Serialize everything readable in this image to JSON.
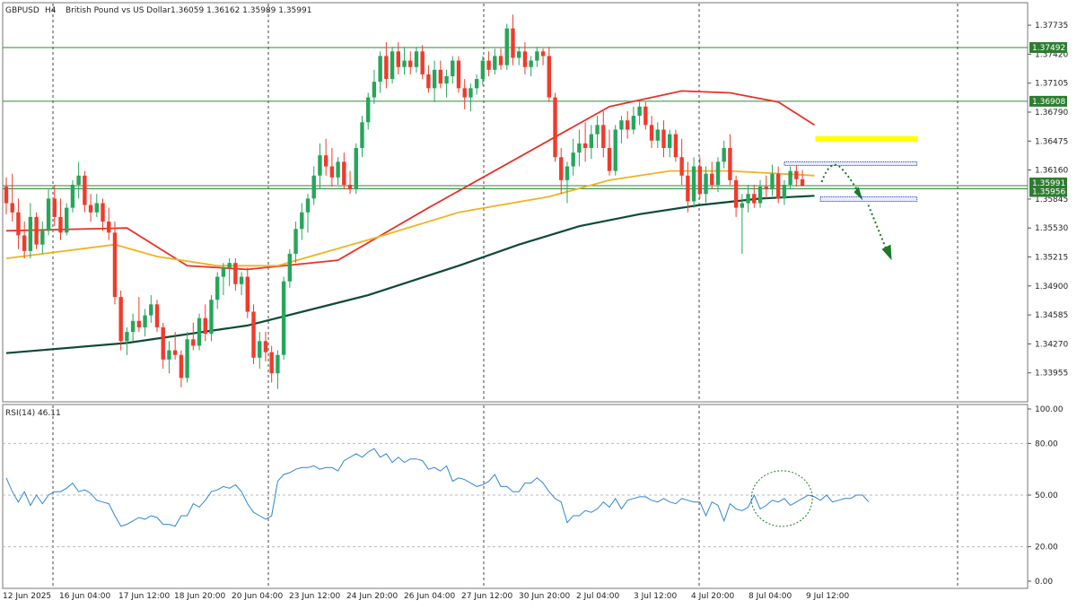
{
  "colors": {
    "bull": "#26a65b",
    "bear": "#ef3b2c",
    "ma_fast": "#e8322a",
    "ma_mid": "#f0b323",
    "ma_slow": "#0f4a33",
    "rsi": "#2f86d6",
    "level_line": "#2e8b3c",
    "resistance_zone": "#ffff00",
    "box_border": "#1f2fbf",
    "arrow": "#1a7a2a",
    "label_bg": "#2e7d32"
  },
  "header": {
    "symbol": "GBPUSD",
    "timeframe": "H4",
    "description": "British Pound vs US Dollar",
    "ohlc": "1.36059 1.36162 1.35989 1.35991"
  },
  "chart_data": [
    {
      "type": "candlestick",
      "y_ticks": [
        "1.37735",
        "1.37420",
        "1.37105",
        "1.36790",
        "1.36475",
        "1.36160",
        "1.35845",
        "1.35530",
        "1.35215",
        "1.34900",
        "1.34585",
        "1.34270",
        "1.33955"
      ],
      "ylim": [
        1.3365,
        1.3797
      ],
      "x_tick_labels": [
        "12 Jun 2025",
        "16 Jun 04:00",
        "17 Jun 12:00",
        "18 Jun 20:00",
        "20 Jun 04:00",
        "23 Jun 12:00",
        "24 Jun 20:00",
        "26 Jun 04:00",
        "27 Jun 12:00",
        "30 Jun 20:00",
        "2 Jul 04:00",
        "3 Jul 12:00",
        "4 Jul 20:00",
        "8 Jul 04:00",
        "9 Jul 12:00"
      ],
      "ohlc": [
        [
          1.3598,
          1.3608,
          1.3568,
          1.358
        ],
        [
          1.358,
          1.3612,
          1.356,
          1.357
        ],
        [
          1.357,
          1.3585,
          1.353,
          1.3545
        ],
        [
          1.3545,
          1.356,
          1.352,
          1.3528
        ],
        [
          1.3528,
          1.358,
          1.352,
          1.3565
        ],
        [
          1.3565,
          1.357,
          1.353,
          1.3535
        ],
        [
          1.3535,
          1.356,
          1.3525,
          1.355
        ],
        [
          1.355,
          1.3595,
          1.3545,
          1.3585
        ],
        [
          1.3585,
          1.36,
          1.3555,
          1.3565
        ],
        [
          1.3565,
          1.3585,
          1.354,
          1.3548
        ],
        [
          1.3548,
          1.358,
          1.3545,
          1.3575
        ],
        [
          1.3575,
          1.3605,
          1.357,
          1.36
        ],
        [
          1.36,
          1.3625,
          1.3585,
          1.361
        ],
        [
          1.361,
          1.3615,
          1.357,
          1.3578
        ],
        [
          1.3578,
          1.359,
          1.356,
          1.357
        ],
        [
          1.357,
          1.359,
          1.3565,
          1.358
        ],
        [
          1.358,
          1.3585,
          1.355,
          1.356
        ],
        [
          1.356,
          1.3575,
          1.354,
          1.3548
        ],
        [
          1.3548,
          1.356,
          1.347,
          1.3478
        ],
        [
          1.3478,
          1.3485,
          1.342,
          1.343
        ],
        [
          1.343,
          1.3445,
          1.3415,
          1.344
        ],
        [
          1.344,
          1.346,
          1.343,
          1.3452
        ],
        [
          1.3452,
          1.3478,
          1.344,
          1.3445
        ],
        [
          1.3445,
          1.3465,
          1.3435,
          1.3458
        ],
        [
          1.3458,
          1.348,
          1.345,
          1.347
        ],
        [
          1.347,
          1.3475,
          1.344,
          1.3445
        ],
        [
          1.3445,
          1.345,
          1.34,
          1.341
        ],
        [
          1.341,
          1.343,
          1.3395,
          1.342
        ],
        [
          1.342,
          1.344,
          1.341,
          1.3415
        ],
        [
          1.3415,
          1.342,
          1.338,
          1.339
        ],
        [
          1.339,
          1.344,
          1.3385,
          1.3432
        ],
        [
          1.3432,
          1.345,
          1.342,
          1.3425
        ],
        [
          1.3425,
          1.346,
          1.342,
          1.3455
        ],
        [
          1.3455,
          1.347,
          1.343,
          1.3438
        ],
        [
          1.3438,
          1.348,
          1.343,
          1.3475
        ],
        [
          1.3475,
          1.3505,
          1.3465,
          1.35
        ],
        [
          1.35,
          1.3515,
          1.348,
          1.351
        ],
        [
          1.351,
          1.352,
          1.349,
          1.3515
        ],
        [
          1.3515,
          1.352,
          1.3485,
          1.3492
        ],
        [
          1.3492,
          1.3505,
          1.348,
          1.35
        ],
        [
          1.35,
          1.351,
          1.3455,
          1.3462
        ],
        [
          1.3462,
          1.347,
          1.3405,
          1.3412
        ],
        [
          1.3412,
          1.344,
          1.34,
          1.343
        ],
        [
          1.343,
          1.344,
          1.3408,
          1.3418
        ],
        [
          1.3418,
          1.3425,
          1.3385,
          1.3395
        ],
        [
          1.3395,
          1.342,
          1.3378,
          1.3415
        ],
        [
          1.3415,
          1.35,
          1.341,
          1.3495
        ],
        [
          1.3495,
          1.353,
          1.3488,
          1.3525
        ],
        [
          1.3525,
          1.356,
          1.3515,
          1.3552
        ],
        [
          1.3552,
          1.358,
          1.354,
          1.357
        ],
        [
          1.357,
          1.359,
          1.3548,
          1.3585
        ],
        [
          1.3585,
          1.362,
          1.3578,
          1.361
        ],
        [
          1.361,
          1.3645,
          1.3595,
          1.3632
        ],
        [
          1.3632,
          1.365,
          1.361,
          1.362
        ],
        [
          1.362,
          1.364,
          1.3598,
          1.3608
        ],
        [
          1.3608,
          1.363,
          1.36,
          1.3625
        ],
        [
          1.3625,
          1.3635,
          1.3595,
          1.36
        ],
        [
          1.36,
          1.3615,
          1.359,
          1.3595
        ],
        [
          1.3595,
          1.3645,
          1.359,
          1.364
        ],
        [
          1.364,
          1.3675,
          1.363,
          1.3668
        ],
        [
          1.3668,
          1.37,
          1.366,
          1.3695
        ],
        [
          1.3695,
          1.3725,
          1.3688,
          1.3712
        ],
        [
          1.3712,
          1.3745,
          1.37,
          1.374
        ],
        [
          1.374,
          1.3755,
          1.3705,
          1.3715
        ],
        [
          1.3715,
          1.375,
          1.371,
          1.3745
        ],
        [
          1.3745,
          1.3755,
          1.372,
          1.3728
        ],
        [
          1.3728,
          1.375,
          1.372,
          1.3735
        ],
        [
          1.3735,
          1.3745,
          1.372,
          1.3728
        ],
        [
          1.3728,
          1.375,
          1.3722,
          1.3745
        ],
        [
          1.3745,
          1.3752,
          1.3715,
          1.372
        ],
        [
          1.372,
          1.373,
          1.37,
          1.3705
        ],
        [
          1.3705,
          1.3735,
          1.369,
          1.3725
        ],
        [
          1.3725,
          1.3735,
          1.3705,
          1.371
        ],
        [
          1.371,
          1.3725,
          1.3695,
          1.3718
        ],
        [
          1.3718,
          1.374,
          1.371,
          1.3735
        ],
        [
          1.3735,
          1.374,
          1.37,
          1.3705
        ],
        [
          1.3705,
          1.3715,
          1.3682,
          1.3695
        ],
        [
          1.3695,
          1.371,
          1.368,
          1.3705
        ],
        [
          1.3705,
          1.372,
          1.3698,
          1.3715
        ],
        [
          1.3715,
          1.374,
          1.3708,
          1.3735
        ],
        [
          1.3735,
          1.3745,
          1.3718,
          1.3725
        ],
        [
          1.3725,
          1.3748,
          1.372,
          1.374
        ],
        [
          1.374,
          1.3748,
          1.3725,
          1.373
        ],
        [
          1.373,
          1.3775,
          1.3725,
          1.377
        ],
        [
          1.377,
          1.3785,
          1.373,
          1.3738
        ],
        [
          1.3738,
          1.375,
          1.373,
          1.3745
        ],
        [
          1.3745,
          1.3755,
          1.372,
          1.3728
        ],
        [
          1.3728,
          1.374,
          1.3718,
          1.3735
        ],
        [
          1.3735,
          1.375,
          1.3728,
          1.3745
        ],
        [
          1.3745,
          1.3748,
          1.373,
          1.374
        ],
        [
          1.374,
          1.375,
          1.369,
          1.3695
        ],
        [
          1.3695,
          1.37,
          1.3625,
          1.363
        ],
        [
          1.363,
          1.364,
          1.359,
          1.3605
        ],
        [
          1.3605,
          1.3625,
          1.358,
          1.362
        ],
        [
          1.362,
          1.365,
          1.361,
          1.3635
        ],
        [
          1.3635,
          1.366,
          1.362,
          1.3645
        ],
        [
          1.3645,
          1.3668,
          1.3625,
          1.364
        ],
        [
          1.364,
          1.3665,
          1.3628,
          1.3655
        ],
        [
          1.3655,
          1.3675,
          1.364,
          1.3665
        ],
        [
          1.3665,
          1.368,
          1.363,
          1.364
        ],
        [
          1.364,
          1.366,
          1.361,
          1.3615
        ],
        [
          1.3615,
          1.3665,
          1.361,
          1.366
        ],
        [
          1.366,
          1.3675,
          1.3645,
          1.367
        ],
        [
          1.367,
          1.368,
          1.365,
          1.366
        ],
        [
          1.366,
          1.3685,
          1.3655,
          1.3675
        ],
        [
          1.3675,
          1.369,
          1.3665,
          1.3685
        ],
        [
          1.3685,
          1.369,
          1.366,
          1.3665
        ],
        [
          1.3665,
          1.3675,
          1.364,
          1.3648
        ],
        [
          1.3648,
          1.3668,
          1.364,
          1.366
        ],
        [
          1.366,
          1.367,
          1.363,
          1.364
        ],
        [
          1.364,
          1.366,
          1.363,
          1.3655
        ],
        [
          1.3655,
          1.366,
          1.3625,
          1.363
        ],
        [
          1.363,
          1.365,
          1.36,
          1.361
        ],
        [
          1.361,
          1.3625,
          1.357,
          1.3582
        ],
        [
          1.3582,
          1.363,
          1.3575,
          1.362
        ],
        [
          1.362,
          1.363,
          1.3585,
          1.359
        ],
        [
          1.359,
          1.362,
          1.358,
          1.3612
        ],
        [
          1.3612,
          1.3625,
          1.3595,
          1.36
        ],
        [
          1.36,
          1.363,
          1.3592,
          1.3625
        ],
        [
          1.3625,
          1.3648,
          1.3618,
          1.364
        ],
        [
          1.364,
          1.3655,
          1.36,
          1.3605
        ],
        [
          1.3605,
          1.361,
          1.3565,
          1.3575
        ],
        [
          1.3575,
          1.359,
          1.3525,
          1.358
        ],
        [
          1.358,
          1.36,
          1.357,
          1.359
        ],
        [
          1.359,
          1.36,
          1.3575,
          1.358
        ],
        [
          1.358,
          1.3605,
          1.3575,
          1.3598
        ],
        [
          1.3598,
          1.361,
          1.3585,
          1.3595
        ],
        [
          1.3595,
          1.3622,
          1.3588,
          1.3612
        ],
        [
          1.3612,
          1.362,
          1.358,
          1.3585
        ],
        [
          1.3585,
          1.3605,
          1.3578,
          1.36
        ],
        [
          1.36,
          1.362,
          1.3595,
          1.3615
        ],
        [
          1.3615,
          1.3625,
          1.3598,
          1.3606
        ],
        [
          1.3606,
          1.3616,
          1.3598,
          1.3599
        ]
      ],
      "moving_averages": [
        {
          "key": "ma_fast",
          "points": [
            [
              0,
              1.355
            ],
            [
              20,
              1.3553
            ],
            [
              30,
              1.3512
            ],
            [
              40,
              1.3508
            ],
            [
              55,
              1.3518
            ],
            [
              70,
              1.3575
            ],
            [
              85,
              1.363
            ],
            [
              100,
              1.3685
            ],
            [
              112,
              1.3702
            ],
            [
              120,
              1.37
            ],
            [
              128,
              1.369
            ],
            [
              134,
              1.3665
            ]
          ]
        },
        {
          "key": "ma_mid",
          "points": [
            [
              0,
              1.352
            ],
            [
              18,
              1.3535
            ],
            [
              25,
              1.3522
            ],
            [
              35,
              1.3512
            ],
            [
              45,
              1.3512
            ],
            [
              60,
              1.354
            ],
            [
              75,
              1.357
            ],
            [
              90,
              1.3587
            ],
            [
              100,
              1.3605
            ],
            [
              110,
              1.3615
            ],
            [
              120,
              1.3615
            ],
            [
              134,
              1.361
            ]
          ]
        },
        {
          "key": "ma_slow",
          "points": [
            [
              0,
              1.3417
            ],
            [
              20,
              1.3428
            ],
            [
              40,
              1.3447
            ],
            [
              60,
              1.348
            ],
            [
              75,
              1.3512
            ],
            [
              85,
              1.3535
            ],
            [
              95,
              1.3555
            ],
            [
              105,
              1.3568
            ],
            [
              115,
              1.3578
            ],
            [
              125,
              1.3585
            ],
            [
              134,
              1.3588
            ]
          ]
        }
      ],
      "horizontal_levels": [
        {
          "price": 1.37492,
          "label": "1.37492"
        },
        {
          "price": 1.36908,
          "label": "1.36908"
        },
        {
          "price": 1.35991,
          "label": "1.35991"
        },
        {
          "price": 1.35956,
          "label": "1.35956"
        }
      ],
      "resistance_zone": {
        "price": 1.365,
        "from_index": 134,
        "to_index": 151
      },
      "boxes": [
        {
          "price_top": 1.3625,
          "price_bottom": 1.3621,
          "from_index": 129,
          "to_index": 151
        },
        {
          "price_top": 1.3587,
          "price_bottom": 1.3582,
          "from_index": 135,
          "to_index": 151
        }
      ]
    },
    {
      "type": "line",
      "label": "RSI(14) 46.11",
      "ylim": [
        0,
        100
      ],
      "y_ticks": [
        "100.00",
        "80.00",
        "50.00",
        "20.00",
        "0.00"
      ],
      "values": [
        60,
        52,
        46,
        52,
        44,
        50,
        45,
        50,
        52,
        52,
        54,
        57,
        52,
        53,
        51,
        47,
        46,
        45,
        38,
        32,
        33,
        35,
        37,
        36,
        38,
        37,
        33,
        33,
        32,
        38,
        38,
        45,
        43,
        47,
        52,
        53,
        55,
        54,
        56,
        52,
        45,
        40,
        38,
        36,
        38,
        58,
        62,
        63,
        65,
        66,
        66,
        67,
        65,
        66,
        66,
        64,
        70,
        72,
        74,
        72,
        75,
        77,
        72,
        74,
        69,
        72,
        69,
        71,
        71,
        70,
        65,
        66,
        64,
        67,
        58,
        60,
        59,
        57,
        55,
        56,
        58,
        62,
        55,
        55,
        52,
        52,
        57,
        57,
        60,
        57,
        52,
        48,
        46,
        34,
        38,
        38,
        41,
        40,
        42,
        46,
        43,
        48,
        42,
        47,
        48,
        49,
        49,
        47,
        46,
        48,
        46,
        45,
        48,
        47,
        46,
        46,
        38,
        46,
        44,
        35,
        45,
        42,
        41,
        43,
        50,
        42,
        44,
        47,
        46,
        48,
        44,
        46,
        48,
        50,
        49,
        47,
        50,
        46,
        47,
        48,
        48,
        50,
        50,
        46
      ],
      "circle": {
        "index": 128,
        "value": 48
      }
    }
  ]
}
